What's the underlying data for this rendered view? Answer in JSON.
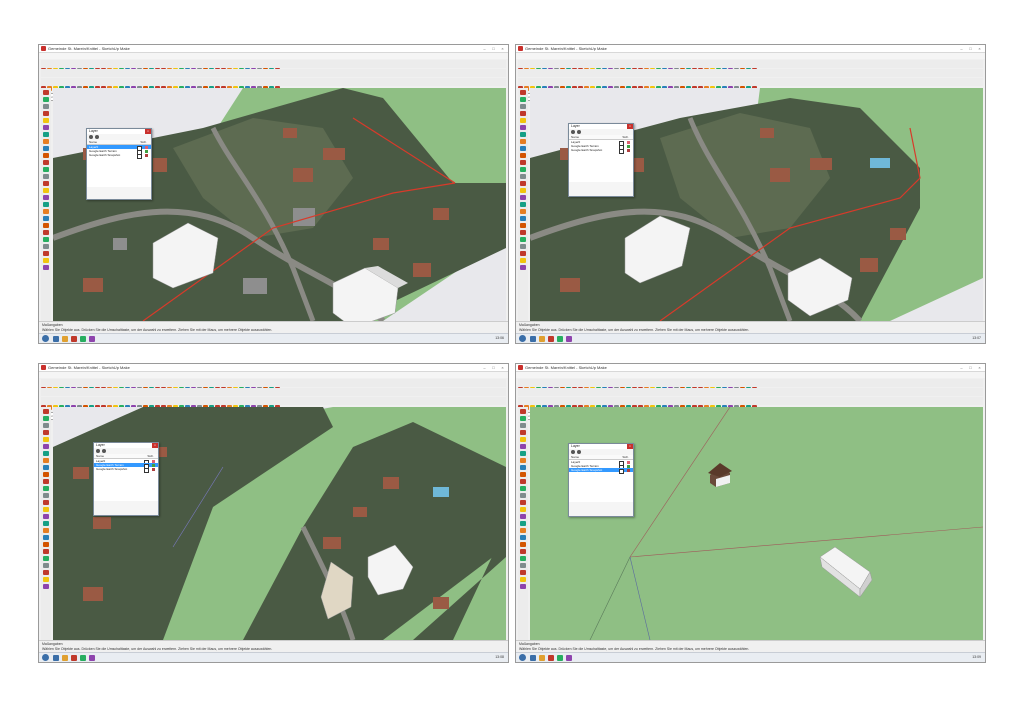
{
  "screens": [
    {
      "window_title": "Gemeinde St. Marein/Knittel - SketchUp Make",
      "menu": [
        "Datei",
        "Bearbeiten",
        "Ansicht",
        "Kamera",
        "Zeichnen",
        "Funktionen",
        "Fenster",
        "Erweiterungen",
        "Hilfe"
      ],
      "layer_select": "Typ: randeltsake",
      "measure_label": "Maßangaben",
      "status_hint": "Wählen Sie Objekte aus. Drücken Sie die Umschalttaste, um der Auswahl zu erweitern. Ziehen Sie mit der Maus, um mehrere Objekte auszuwählen.",
      "clock": "13:06",
      "dialog": {
        "title": "Layer",
        "col_name": "Name",
        "col_visible": "Sich.",
        "col_color": "F",
        "layers": [
          {
            "name": "Layer0",
            "selected": true,
            "color": "#e06070"
          },
          {
            "name": "Google Earth Terrain",
            "selected": false,
            "color": "#40a040"
          },
          {
            "name": "Google Earth Snapshot",
            "selected": false,
            "color": "#b04040"
          }
        ]
      }
    },
    {
      "window_title": "Gemeinde St. Marein/Knittel - SketchUp Make",
      "menu": [
        "Datei",
        "Bearbeiten",
        "Ansicht",
        "Kamera",
        "Zeichnen",
        "Funktionen",
        "Fenster",
        "Erweiterungen",
        "Hilfe"
      ],
      "layer_select": "Typ: randeltsake",
      "measure_label": "Maßangaben",
      "status_hint": "Wählen Sie Objekte aus. Drücken Sie die Umschalttaste, um der Auswahl zu erweitern. Ziehen Sie mit der Maus, um mehrere Objekte auszuwählen.",
      "clock": "13:07",
      "dialog": {
        "title": "Layer",
        "col_name": "Name",
        "col_visible": "Sich.",
        "col_color": "F",
        "layers": [
          {
            "name": "Layer0",
            "selected": false,
            "color": "#e06070"
          },
          {
            "name": "Google Earth Terrain",
            "selected": false,
            "color": "#40a040"
          },
          {
            "name": "Google Earth Snapshot",
            "selected": false,
            "color": "#b04040"
          }
        ]
      }
    },
    {
      "window_title": "Gemeinde St. Marein/Knittel - SketchUp Make",
      "menu": [
        "Datei",
        "Bearbeiten",
        "Ansicht",
        "Kamera",
        "Zeichnen",
        "Funktionen",
        "Fenster",
        "Erweiterungen",
        "Hilfe"
      ],
      "layer_select": "Typ: randeltsake",
      "measure_label": "Maßangaben",
      "status_hint": "Wählen Sie Objekte aus. Drücken Sie die Umschalttaste, um der Auswahl zu erweitern. Ziehen Sie mit der Maus, um mehrere Objekte auszuwählen.",
      "clock": "13:08",
      "dialog": {
        "title": "Layer",
        "col_name": "Name",
        "col_visible": "Sich.",
        "col_color": "F",
        "layers": [
          {
            "name": "Layer0",
            "selected": false,
            "color": "#e06070"
          },
          {
            "name": "Google Earth Terrain",
            "selected": true,
            "color": "#40a040"
          },
          {
            "name": "Google Earth Snapshot",
            "selected": false,
            "color": "#b04040"
          }
        ]
      }
    },
    {
      "window_title": "Gemeinde St. Marein/Knittel - SketchUp Make",
      "menu": [
        "Datei",
        "Bearbeiten",
        "Ansicht",
        "Kamera",
        "Zeichnen",
        "Funktionen",
        "Fenster",
        "Erweiterungen",
        "Hilfe"
      ],
      "layer_select": "Typ: randeltsake",
      "measure_label": "Maßangaben",
      "status_hint": "Wählen Sie Objekte aus. Drücken Sie die Umschalttaste, um der Auswahl zu erweitern. Ziehen Sie mit der Maus, um mehrere Objekte auszuwählen.",
      "clock": "13:09",
      "dialog": {
        "title": "Layer",
        "col_name": "Name",
        "col_visible": "Sich.",
        "col_color": "F",
        "layers": [
          {
            "name": "Layer0",
            "selected": false,
            "color": "#e06070"
          },
          {
            "name": "Google Earth Terrain",
            "selected": false,
            "color": "#40a040"
          },
          {
            "name": "Google Earth Snapshot",
            "selected": true,
            "color": "#b04040"
          }
        ]
      }
    }
  ],
  "colors": {
    "terrain_green": "#8fbf84",
    "sky": "#e8e8ec",
    "aerial_dark": "#4a5a44",
    "roof_brown": "#9a5a44",
    "selection_red": "#d83a2a",
    "building_white": "#f4f4f4"
  }
}
